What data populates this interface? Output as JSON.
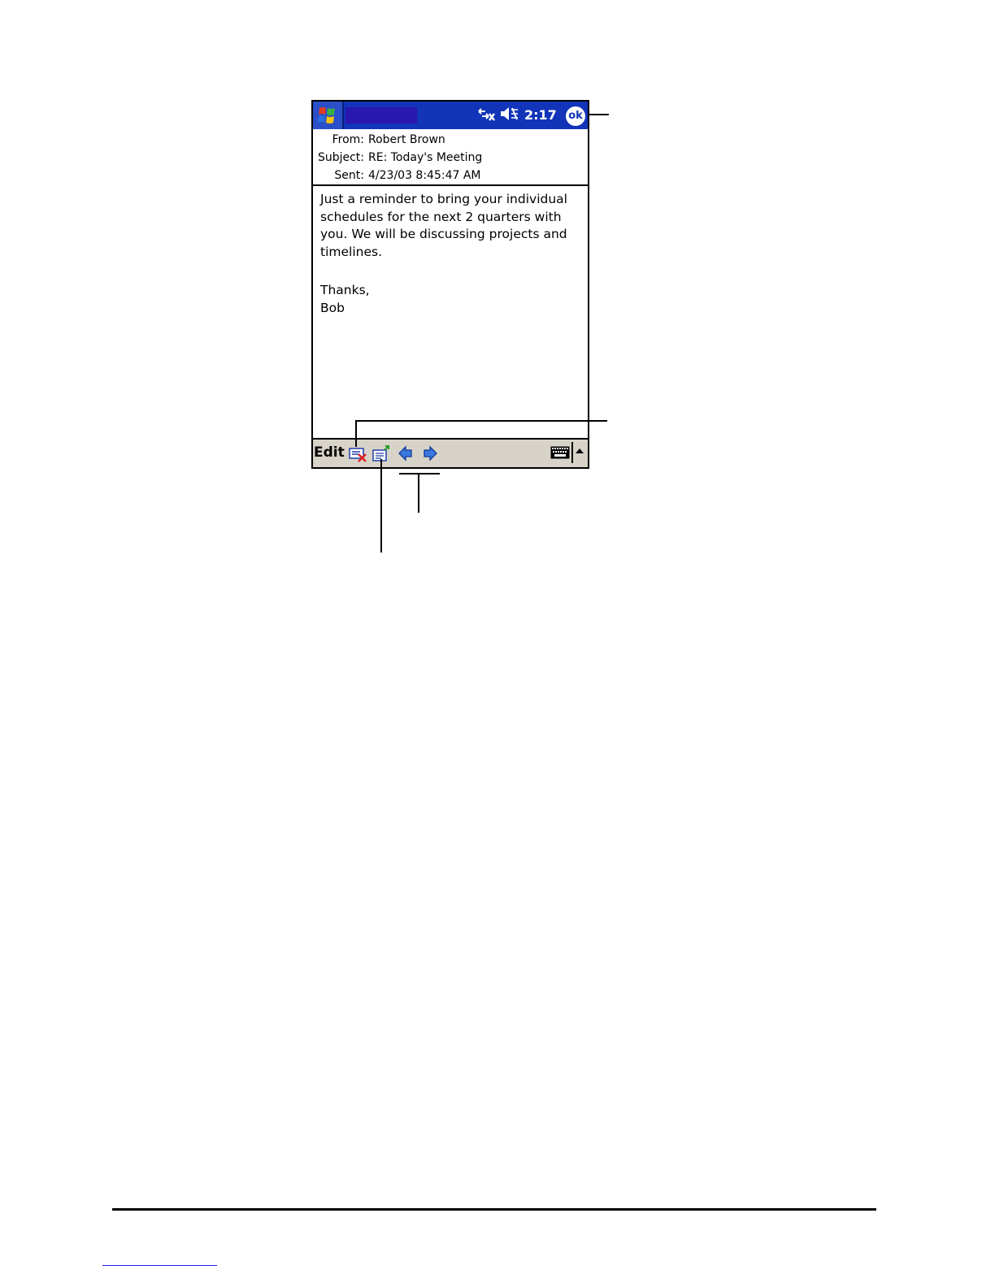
{
  "titlebar": {
    "title": "",
    "clock": "2:17",
    "ok_label": "ok",
    "icons": [
      "start-logo-icon",
      "connectivity-icon",
      "speaker-muted-icon",
      "ok-icon"
    ]
  },
  "message": {
    "from_label": "From:",
    "from_value": "Robert Brown",
    "subject_label": "Subject:",
    "subject_value": "RE: Today's Meeting",
    "sent_label": "Sent:",
    "sent_value": "4/23/03 8:45:47 AM",
    "body_line1": "Just a reminder to bring your individual",
    "body_line2": "schedules for the next 2 quarters with",
    "body_line3": "you. We will be discussing projects and",
    "body_line4": "timelines.",
    "signoff1": "Thanks,",
    "signoff2": "Bob"
  },
  "menubar": {
    "edit_label": "Edit",
    "icons": [
      "delete-message-icon",
      "reply-icon",
      "previous-arrow-icon",
      "next-arrow-icon",
      "keyboard-icon",
      "sip-up-arrow-icon"
    ]
  },
  "colors": {
    "titlebar": "#1134b8",
    "menubar": "#d8d3c8",
    "accent_red": "#e02020"
  }
}
